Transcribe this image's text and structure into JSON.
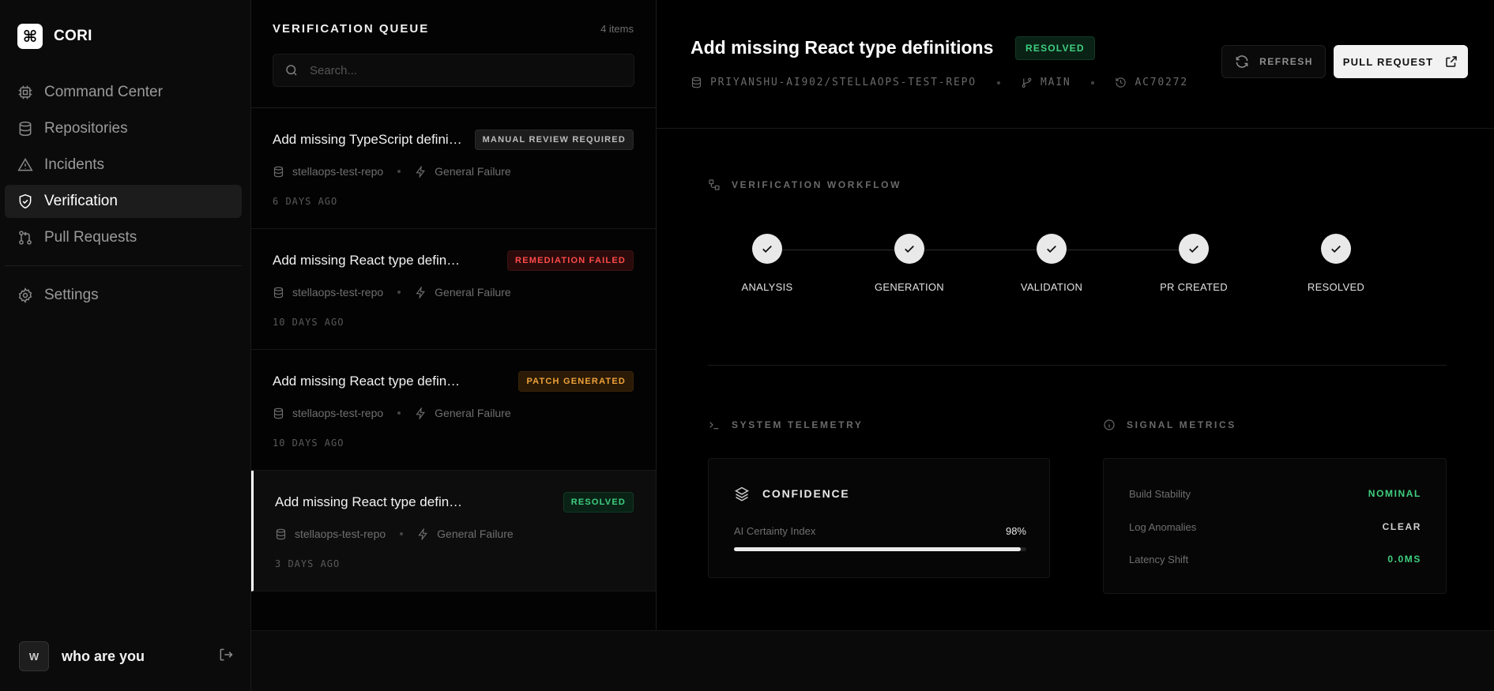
{
  "app": {
    "name": "CORI",
    "logo_glyph": "⌘"
  },
  "sidebar": {
    "items": [
      {
        "label": "Command Center",
        "icon": "cpu-icon"
      },
      {
        "label": "Repositories",
        "icon": "database-icon"
      },
      {
        "label": "Incidents",
        "icon": "alert-triangle-icon"
      },
      {
        "label": "Verification",
        "icon": "shield-check-icon",
        "active": true
      },
      {
        "label": "Pull Requests",
        "icon": "git-pull-request-icon"
      }
    ],
    "settings_label": "Settings",
    "user": {
      "initial": "W",
      "name": "who are you"
    }
  },
  "queue": {
    "title": "VERIFICATION QUEUE",
    "count": "4 items",
    "search_placeholder": "Search...",
    "items": [
      {
        "title": "Add missing TypeScript definitions",
        "badge": "MANUAL REVIEW REQUIRED",
        "badge_color": "#bdbdbd",
        "repo": "stellaops-test-repo",
        "type": "General Failure",
        "time": "6 DAYS AGO"
      },
      {
        "title": "Add missing React type definitions",
        "badge": "REMEDIATION FAILED",
        "badge_color": "#ff4a4a",
        "repo": "stellaops-test-repo",
        "type": "General Failure",
        "time": "10 DAYS AGO"
      },
      {
        "title": "Add missing React type definitions",
        "badge": "PATCH GENERATED",
        "badge_color": "#f0a23a",
        "repo": "stellaops-test-repo",
        "type": "General Failure",
        "time": "10 DAYS AGO"
      },
      {
        "title": "Add missing React type definitions",
        "badge": "RESOLVED",
        "badge_color": "#3ecf7f",
        "repo": "stellaops-test-repo",
        "type": "General Failure",
        "time": "3 DAYS AGO"
      }
    ]
  },
  "detail": {
    "title": "Add missing React type definitions",
    "status": "RESOLVED",
    "repo": "PRIYANSHU-AI902/STELLAOPS-TEST-REPO",
    "branch": "MAIN",
    "commit": "AC70272",
    "refresh_label": "REFRESH",
    "pr_label": "PULL REQUEST",
    "workflow_title": "VERIFICATION WORKFLOW",
    "workflow_steps": [
      "ANALYSIS",
      "GENERATION",
      "VALIDATION",
      "PR CREATED",
      "RESOLVED"
    ],
    "telemetry_title": "SYSTEM TELEMETRY",
    "metrics_title": "SIGNAL METRICS",
    "confidence": {
      "title": "CONFIDENCE",
      "label": "AI Certainty Index",
      "value": "98%",
      "fraction": 0.98
    },
    "metrics": [
      {
        "label": "Build Stability",
        "value": "NOMINAL",
        "color": "#3ecf7f"
      },
      {
        "label": "Log Anomalies",
        "value": "CLEAR",
        "color": "#cfcfcf"
      },
      {
        "label": "Latency Shift",
        "value": "0.0MS",
        "color": "#3ecf7f"
      }
    ]
  },
  "colors": {
    "accent_green": "#3ecf7f",
    "danger": "#ff4a4a",
    "warning": "#f0a23a"
  }
}
